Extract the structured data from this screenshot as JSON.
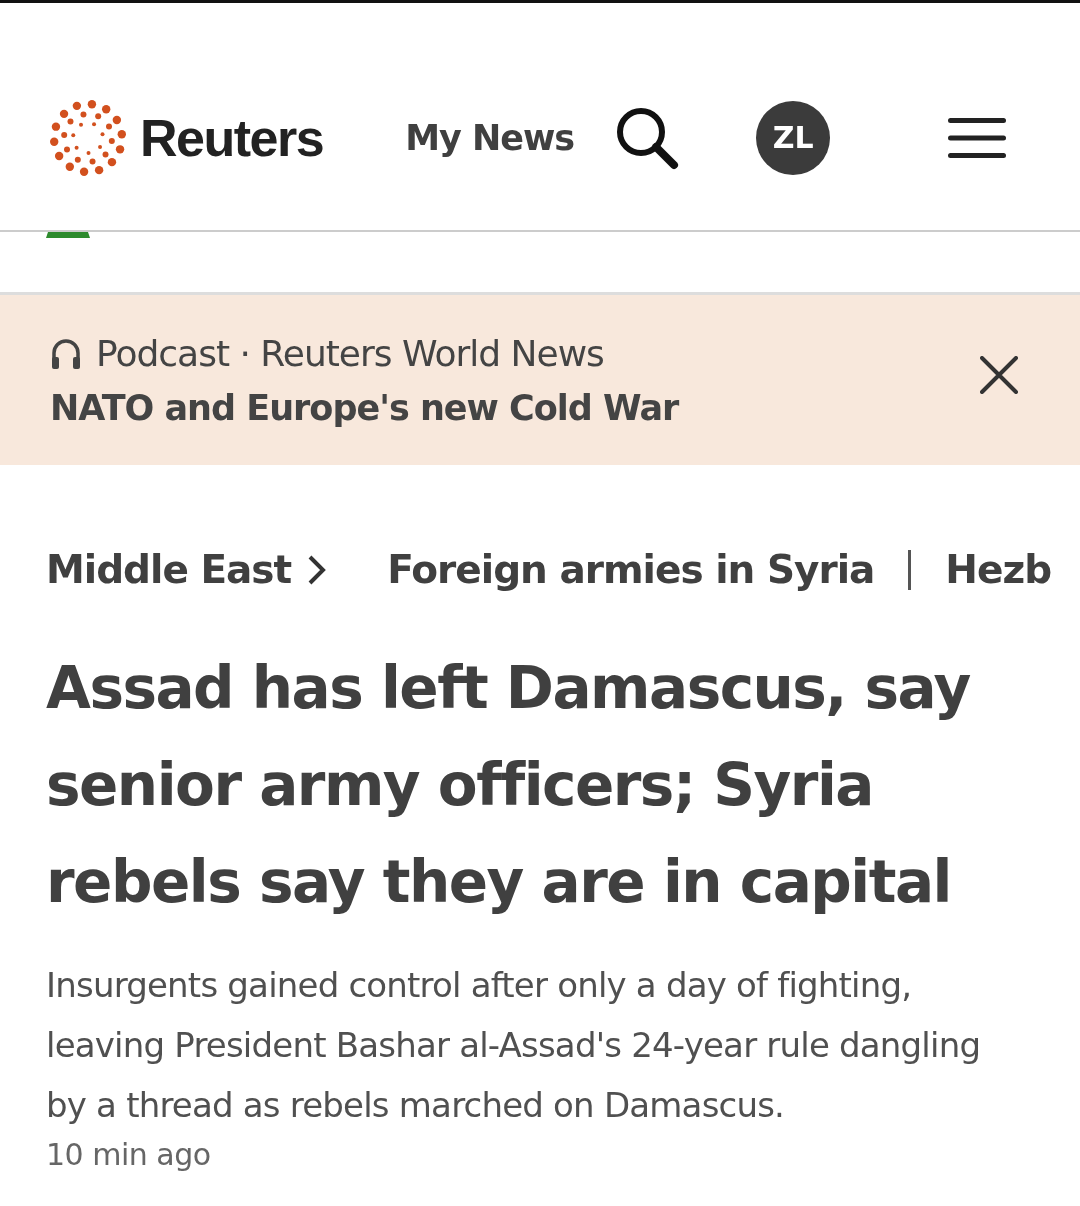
{
  "header": {
    "brand": "Reuters",
    "my_news": "My News",
    "avatar": "ZL"
  },
  "podcast": {
    "label": "Podcast · Reuters World News",
    "title": "NATO and Europe's new Cold War"
  },
  "breadcrumb": {
    "section": "Middle East",
    "topics": [
      "Foreign armies in Syria",
      "Hezb"
    ]
  },
  "article": {
    "headline": "Assad has left Damascus, say senior army officers; Syria rebels say they are in capital",
    "summary": "Insurgents gained control after only a day of fighting, leaving President Bashar al-Assad's 24-year rule dangling by a thread as rebels marched on Damascus.",
    "time": "10 min ago"
  }
}
